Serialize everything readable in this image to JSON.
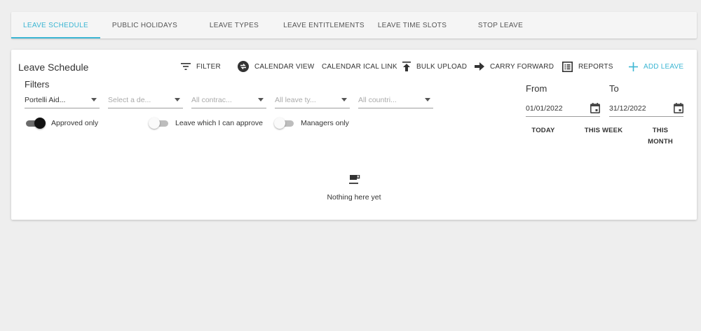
{
  "tabs": [
    {
      "label": "LEAVE SCHEDULE",
      "active": true
    },
    {
      "label": "PUBLIC HOLIDAYS",
      "active": false
    },
    {
      "label": "LEAVE TYPES",
      "active": false
    },
    {
      "label": "LEAVE ENTITLEMENTS",
      "active": false
    },
    {
      "label": "LEAVE TIME SLOTS",
      "active": false
    },
    {
      "label": "STOP LEAVE",
      "active": false
    }
  ],
  "card": {
    "title": "Leave Schedule"
  },
  "toolbar": {
    "filter": {
      "label": "FILTER",
      "icon": "filter-icon"
    },
    "calendar_view": {
      "label": "CALENDAR VIEW",
      "icon": "swap-icon"
    },
    "calendar_ical": {
      "label": "CALENDAR ICAL LINK"
    },
    "bulk_upload": {
      "label": "BULK UPLOAD",
      "icon": "upload-icon"
    },
    "carry_forward": {
      "label": "CARRY FORWARD",
      "icon": "arrow-right-icon"
    },
    "reports": {
      "label": "REPORTS",
      "icon": "reports-icon"
    },
    "add_leave": {
      "label": "ADD LEAVE",
      "icon": "plus-icon"
    }
  },
  "filters": {
    "label": "Filters",
    "selects": [
      {
        "value": "Portelli Aid...",
        "placeholder": false
      },
      {
        "value": "Select a de...",
        "placeholder": true
      },
      {
        "value": "All contrac...",
        "placeholder": true
      },
      {
        "value": "All leave ty...",
        "placeholder": true
      },
      {
        "value": "All countri...",
        "placeholder": true
      }
    ],
    "toggles": [
      {
        "label": "Approved only",
        "on": true
      },
      {
        "label": "Leave which I can approve",
        "on": false
      },
      {
        "label": "Managers only",
        "on": false
      }
    ]
  },
  "dates": {
    "from_label": "From",
    "from_value": "01/01/2022",
    "to_label": "To",
    "to_value": "31/12/2022",
    "quick": {
      "today": "TODAY",
      "this_week": "THIS WEEK",
      "this_month_1": "THIS",
      "this_month_2": "MONTH"
    }
  },
  "empty": {
    "text": "Nothing here yet",
    "icon": "coffee-cup-icon"
  },
  "colors": {
    "accent": "#3cb6d3",
    "background": "#eeeeee",
    "card": "#ffffff"
  }
}
